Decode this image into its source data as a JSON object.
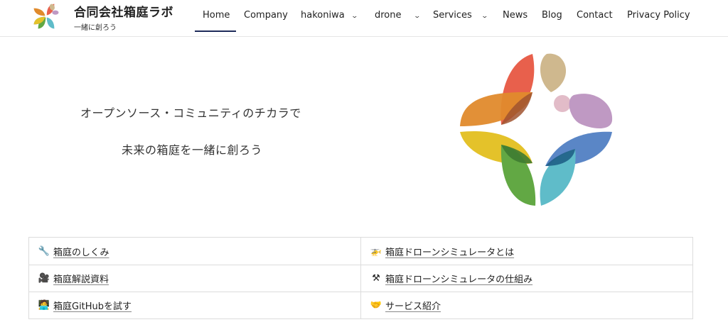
{
  "site": {
    "title": "合同会社箱庭ラボ",
    "tagline": "一緒に創ろう"
  },
  "nav": {
    "items": [
      {
        "label": "Home",
        "active": true,
        "dropdown": false
      },
      {
        "label": "Company",
        "dropdown": false
      },
      {
        "label": "hakoniwa",
        "dropdown": true
      },
      {
        "label": "drone",
        "dropdown": true
      },
      {
        "label": "Services",
        "dropdown": true
      },
      {
        "label": "News",
        "dropdown": false
      },
      {
        "label": "Blog",
        "dropdown": false
      },
      {
        "label": "Contact",
        "dropdown": false
      },
      {
        "label": "Privacy Policy",
        "dropdown": false
      }
    ],
    "chevron": "⌄"
  },
  "hero": {
    "line1": "オープンソース・コミュニティのチカラで",
    "line2": "未来の箱庭を一緒に創ろう"
  },
  "links": [
    {
      "icon": "wrench-icon",
      "emoji": "🔧",
      "label": "箱庭のしくみ"
    },
    {
      "icon": "helicopter-icon",
      "emoji": "🚁",
      "label": "箱庭ドローンシミュレータとは"
    },
    {
      "icon": "movie-camera-icon",
      "emoji": "🎥",
      "label": "箱庭解説資料"
    },
    {
      "icon": "hammer-pick-icon",
      "emoji": "⚒",
      "label": "箱庭ドローンシミュレータの仕組み"
    },
    {
      "icon": "technologist-icon",
      "emoji": "🧑‍💻",
      "label": "箱庭GitHubを試す"
    },
    {
      "icon": "handshake-icon",
      "emoji": "🤝",
      "label": "サービス紹介"
    }
  ],
  "colors": {
    "nav_active_underline": "#1e2b5a",
    "logo_red": "#e8604c",
    "logo_orange": "#e08a2c",
    "logo_tan": "#cfb88e",
    "logo_pink": "#e2bcc8",
    "logo_purple": "#bf99c3",
    "logo_blue": "#5a86c6",
    "logo_teal": "#5fbcc9",
    "logo_green": "#62a844",
    "logo_yellow": "#e4c22a"
  }
}
